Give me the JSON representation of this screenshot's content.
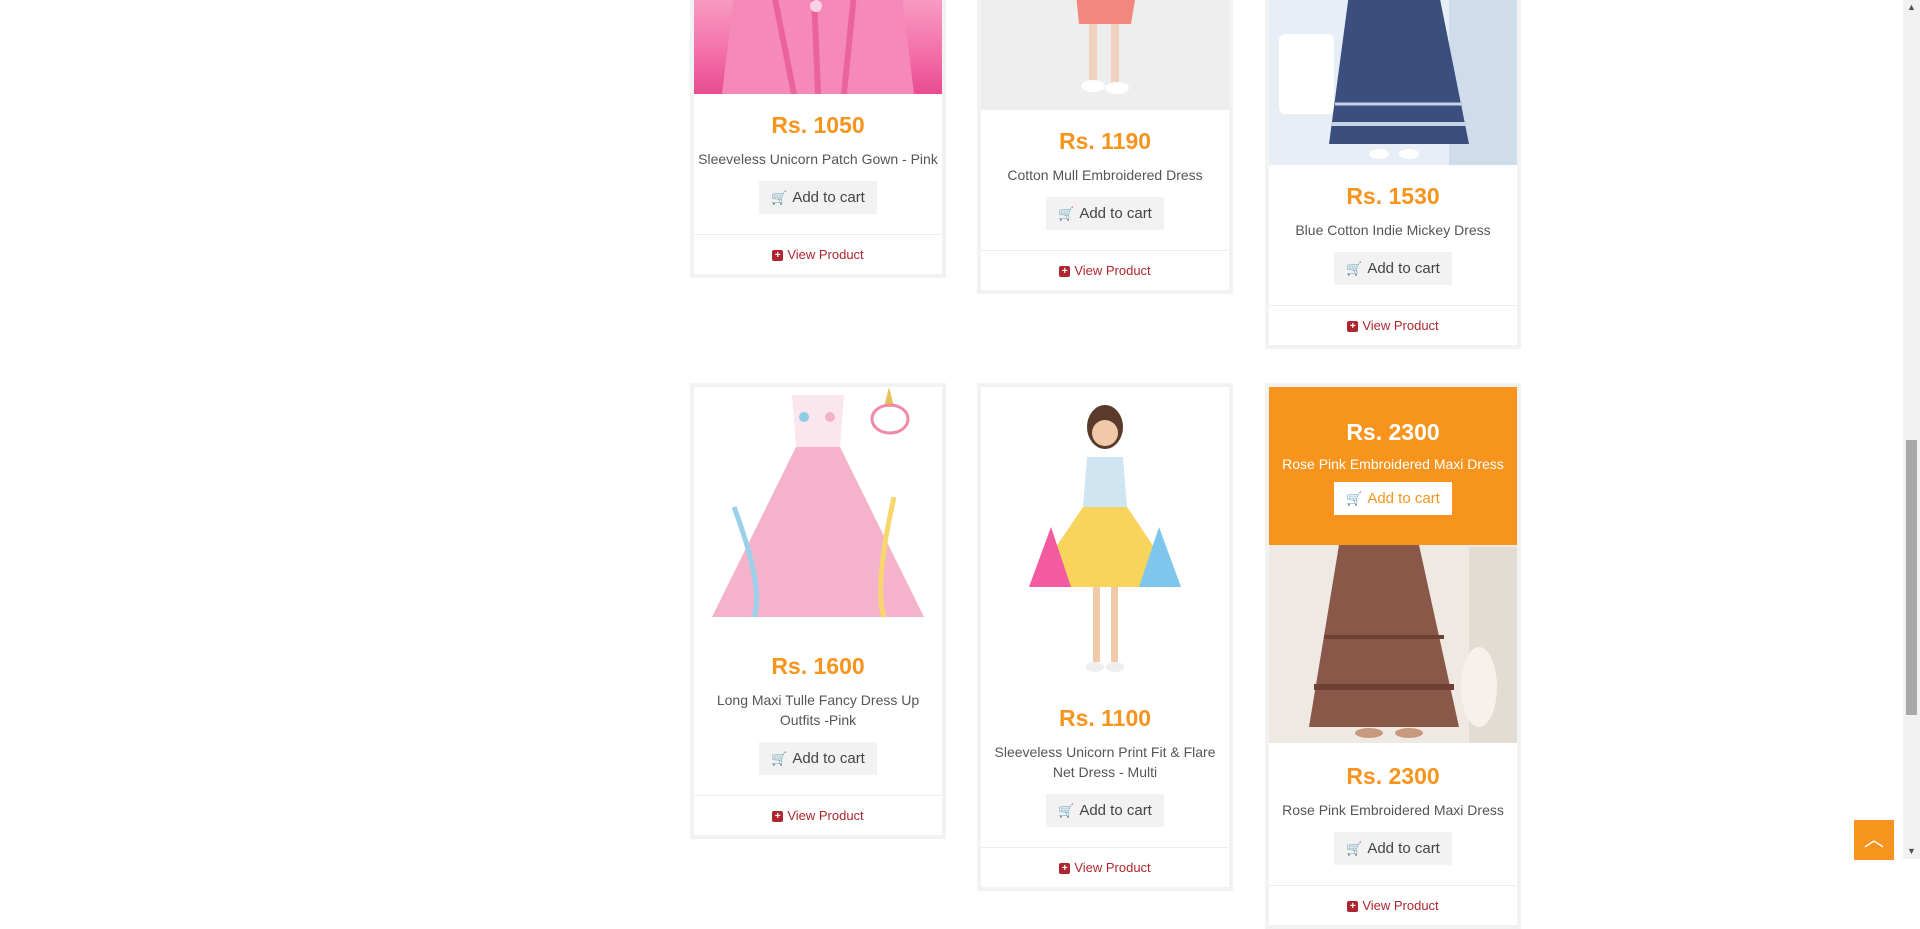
{
  "products": [
    {
      "price": "Rs. 1050",
      "name": "Sleeveless Unicorn Patch Gown - Pink",
      "cart": "Add to cart",
      "view": "View Product"
    },
    {
      "price": "Rs. 1190",
      "name": "Cotton Mull Embroidered Dress",
      "cart": "Add to cart",
      "view": "View Product"
    },
    {
      "price": "Rs. 1530",
      "name": "Blue Cotton Indie Mickey Dress",
      "cart": "Add to cart",
      "view": "View Product"
    },
    {
      "price": "Rs. 1600",
      "name": "Long Maxi Tulle Fancy Dress Up Outfits -Pink",
      "cart": "Add to cart",
      "view": "View Product"
    },
    {
      "price": "Rs. 1100",
      "name": "Sleeveless Unicorn Print Fit & Flare Net Dress - Multi",
      "cart": "Add to cart",
      "view": "View Product"
    },
    {
      "price": "Rs. 2300",
      "name": "Rose Pink Embroidered Maxi Dress",
      "cart": "Add to cart",
      "view": "View Product"
    }
  ],
  "hover_overlay": {
    "price": "Rs. 2300",
    "name": "Rose Pink Embroidered Maxi Dress",
    "cart": "Add to cart"
  },
  "icons": {
    "cart": "cart-icon",
    "plus": "plus-square-icon",
    "scroll_top": "chevron-up-icon"
  },
  "colors": {
    "accent": "#f7941d",
    "link": "#b0262f"
  }
}
